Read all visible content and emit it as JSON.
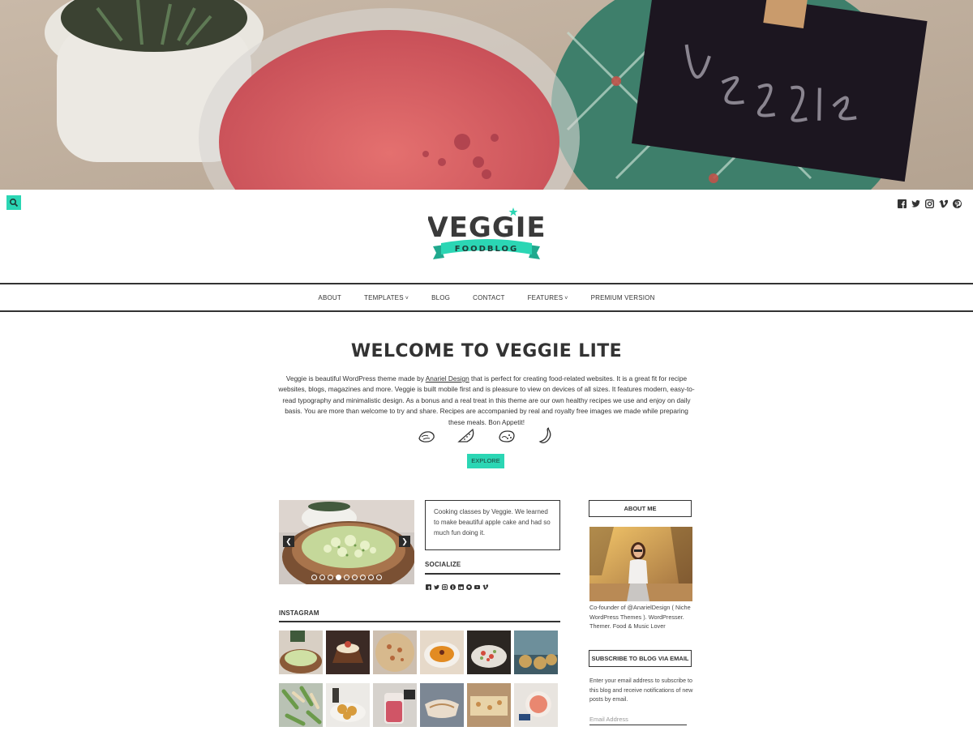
{
  "header": {
    "hero_alt": "",
    "social_icons": [
      "facebook-icon",
      "twitter-icon",
      "instagram-icon",
      "vimeo-icon",
      "pinterest-icon"
    ]
  },
  "logo": {
    "title": "VEGGIE",
    "ribbon": "FOODBLOG"
  },
  "nav": {
    "items": [
      {
        "label": "ABOUT",
        "has_dropdown": false
      },
      {
        "label": "TEMPLATES",
        "has_dropdown": true
      },
      {
        "label": "BLOG",
        "has_dropdown": false
      },
      {
        "label": "CONTACT",
        "has_dropdown": false
      },
      {
        "label": "FEATURES",
        "has_dropdown": true
      },
      {
        "label": "PREMIUM VERSION",
        "has_dropdown": false
      }
    ]
  },
  "welcome": {
    "title": "WELCOME TO VEGGIE LITE",
    "text_before_link": "Veggie is beautiful WordPress theme made by ",
    "link_text": "Anariel Design",
    "text_after_link": " that is perfect for creating food-related websites. It is a great fit for recipe websites, blogs, magazines and more. Veggie is built mobile first and is pleasure to view on devices of all sizes. It features modern, easy-to-read typography and minimalistic design. As a bonus and a real treat in this theme are our own healthy recipes we use and enjoy on daily basis. You are more than welcome to try and share. Recipes are accompanied by real and royalty free images we made while preparing these meals. Bon Appetit!",
    "food_icons": [
      "lemon-icon",
      "watermelon-icon",
      "cookie-icon",
      "banana-icon"
    ],
    "button_label": "EXPLORE"
  },
  "slider": {
    "dot_count": 9,
    "active_index": 3
  },
  "caption": {
    "text": "Cooking classes by Veggie. We learned to make beautiful apple cake and had so much fun doing it."
  },
  "socialize": {
    "title": "SOCIALIZE",
    "icons": [
      "facebook-icon",
      "twitter-icon",
      "instagram-icon",
      "pinterest-icon",
      "linkedin-icon",
      "github-icon",
      "youtube-icon",
      "vimeo-icon"
    ]
  },
  "instagram": {
    "title": "INSTAGRAM",
    "photo_count": 12
  },
  "sidebar": {
    "about_title": "ABOUT ME",
    "about_text": "Co-founder of @AnarielDesign ( Niche WordPress Themes ). WordPresser. Themer. Food & Music Lover",
    "subscribe_title": "SUBSCRIBE TO BLOG VIA EMAIL",
    "subscribe_text": "Enter your email address to subscribe to this blog and receive notifications of new posts by email.",
    "email_placeholder": "Email Address"
  },
  "colors": {
    "accent": "#2bd6b4",
    "text": "#333333"
  }
}
